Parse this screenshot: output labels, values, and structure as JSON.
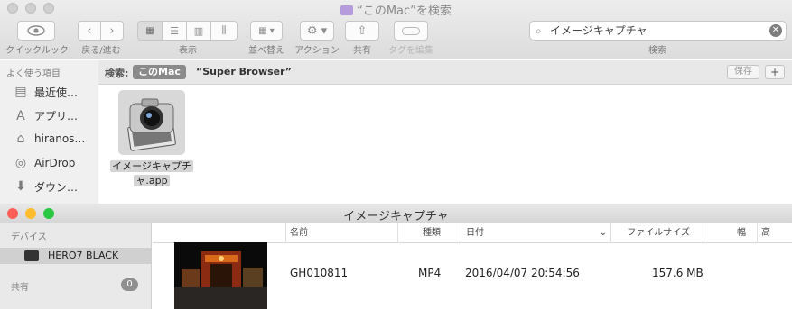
{
  "finder": {
    "title": "“このMac”を検索",
    "toolbar": {
      "quicklook_label": "クイックルック",
      "backforward_label": "戻る/進む",
      "view_label": "表示",
      "arrange_label": "並べ替え",
      "action_label": "アクション",
      "share_label": "共有",
      "tag_label": "タグを編集",
      "search_label": "検索"
    },
    "search": {
      "value": "イメージキャプチャ"
    },
    "sidebar": {
      "header": "よく使う項目",
      "items": [
        {
          "label": "最近使…",
          "icon": "recents-icon"
        },
        {
          "label": "アプリ…",
          "icon": "applications-icon"
        },
        {
          "label": "hiranos…",
          "icon": "home-icon"
        },
        {
          "label": "AirDrop",
          "icon": "airdrop-icon"
        },
        {
          "label": "ダウン…",
          "icon": "downloads-icon"
        }
      ]
    },
    "scope": {
      "label": "検索:",
      "scope_button": "このMac",
      "term": "“Super Browser”",
      "save_label": "保存",
      "add_label": "+"
    },
    "result": {
      "line1": "イメージキャプチ",
      "line2": "ャ.app"
    }
  },
  "imagecapture": {
    "title": "イメージキャプチャ",
    "sidebar": {
      "devices_header": "デバイス",
      "device_name": "HERO7 BLACK",
      "shared_header": "共有",
      "shared_count": "0"
    },
    "columns": {
      "name": "名前",
      "kind": "種類",
      "date": "日付",
      "size": "ファイルサイズ",
      "width": "幅",
      "height": "高"
    },
    "row": {
      "name": "GH010811",
      "kind": "MP4",
      "date": "2016/04/07 20:54:56",
      "size": "157.6 MB"
    }
  }
}
